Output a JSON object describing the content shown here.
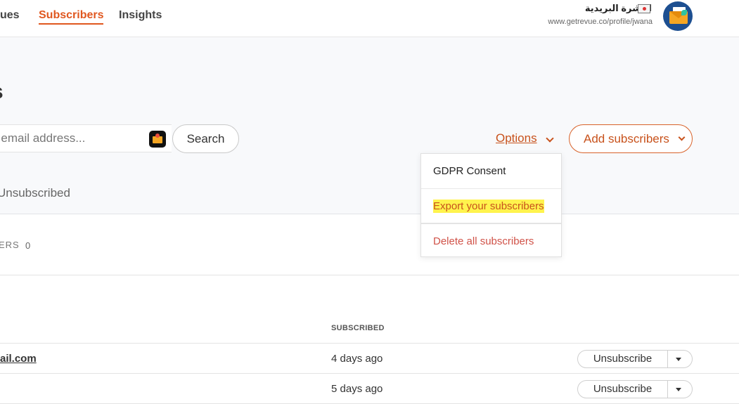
{
  "nav": {
    "issues": "ues",
    "subscribers": "Subscribers",
    "insights": "Insights"
  },
  "profile": {
    "name": "النشرة البريدية",
    "url": "www.getrevue.co/profile/jwana"
  },
  "page": {
    "title": "s"
  },
  "search": {
    "placeholder": "r email address...",
    "button_label": "Search"
  },
  "actions": {
    "options_label": "Options",
    "add_label": "Add subscribers"
  },
  "options_menu": {
    "items": [
      "GDPR Consent",
      "Export your subscribers",
      "Delete all subscribers"
    ]
  },
  "tabs": {
    "unsubscribed": "Unsubscribed"
  },
  "stats": {
    "label": "ERS",
    "value": "0"
  },
  "table": {
    "column_subscribed": "SUBSCRIBED",
    "rows": [
      {
        "email": "ail.com",
        "subscribed": "4 days ago",
        "action": "Unsubscribe"
      },
      {
        "email": "",
        "subscribed": "5 days ago",
        "action": "Unsubscribe"
      }
    ]
  },
  "colors": {
    "accent": "#e0571f",
    "danger": "#d05248",
    "highlight": "#fff34d"
  }
}
